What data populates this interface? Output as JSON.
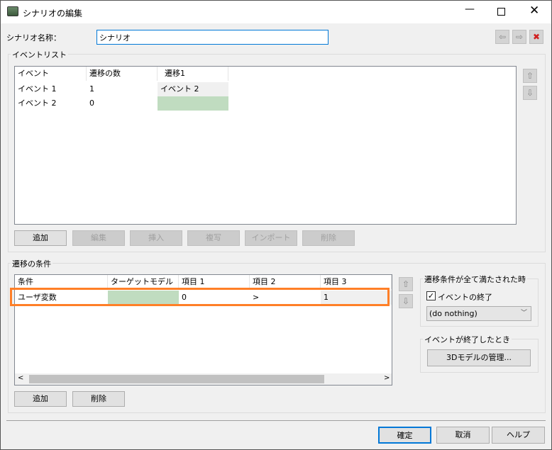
{
  "window": {
    "title": "シナリオの編集"
  },
  "name_field": {
    "label": "シナリオ名称：",
    "value": "シナリオ"
  },
  "event_list": {
    "legend": "イベントリスト",
    "columns": [
      "イベント",
      "遷移の数",
      "遷移1"
    ],
    "rows": [
      [
        "イベント 1",
        "1",
        "イベント 2"
      ],
      [
        "イベント 2",
        "0",
        ""
      ]
    ],
    "buttons": {
      "add": "追加",
      "edit": "編集",
      "insert": "挿入",
      "copy": "複写",
      "import": "インポート",
      "delete": "削除"
    }
  },
  "conditions": {
    "legend": "遷移の条件",
    "columns": [
      "条件",
      "ターゲットモデル",
      "項目 1",
      "項目 2",
      "項目 3"
    ],
    "rows": [
      [
        "ユーザ変数",
        "",
        "0",
        ">",
        "1"
      ]
    ],
    "buttons": {
      "add": "追加",
      "delete": "削除"
    }
  },
  "all_met": {
    "legend": "遷移条件が全て満たされた時",
    "checkbox_label": "イベントの終了",
    "checked": true,
    "select_value": "(do nothing)"
  },
  "on_end": {
    "legend": "イベントが終了したとき",
    "button": "3Dモデルの管理..."
  },
  "footer": {
    "ok": "確定",
    "cancel": "取消",
    "help": "ヘルプ"
  },
  "colors": {
    "highlight": "#ff7f27",
    "green_cell": "#c0dcc0",
    "accent": "#0078d7"
  }
}
